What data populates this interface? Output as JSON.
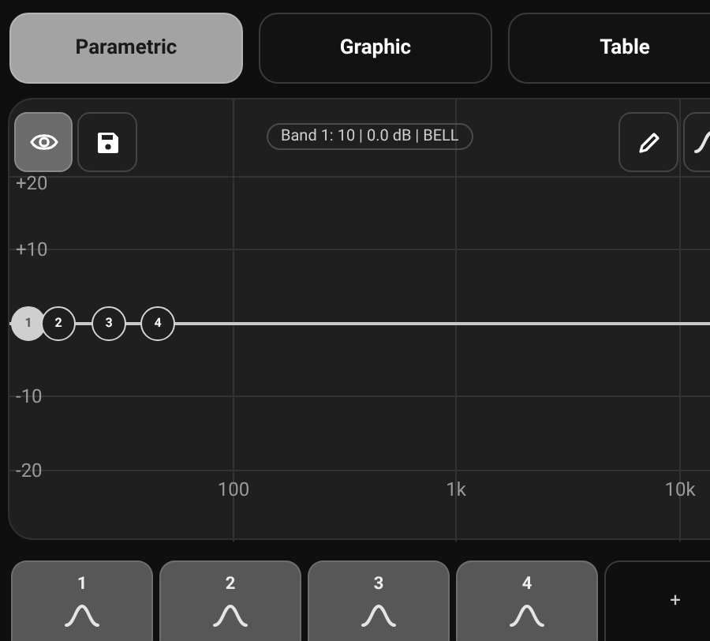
{
  "tabs": [
    {
      "label": "Parametric",
      "selected": true
    },
    {
      "label": "Graphic",
      "selected": false
    },
    {
      "label": "Table",
      "selected": false
    }
  ],
  "graph": {
    "band_info": "Band 1: 10 | 0.0 dB | BELL",
    "view_toggle": {
      "on": true
    },
    "y_labels": [
      "+20",
      "+10",
      "-10",
      "-20"
    ],
    "x_labels": [
      "100",
      "1k",
      "10k"
    ],
    "nodes": [
      {
        "label": "1",
        "selected": true
      },
      {
        "label": "2",
        "selected": false
      },
      {
        "label": "3",
        "selected": false
      },
      {
        "label": "4",
        "selected": false
      }
    ]
  },
  "bands": [
    {
      "label": "1"
    },
    {
      "label": "2"
    },
    {
      "label": "3"
    },
    {
      "label": "4"
    }
  ],
  "add_band": {
    "label": "+"
  }
}
